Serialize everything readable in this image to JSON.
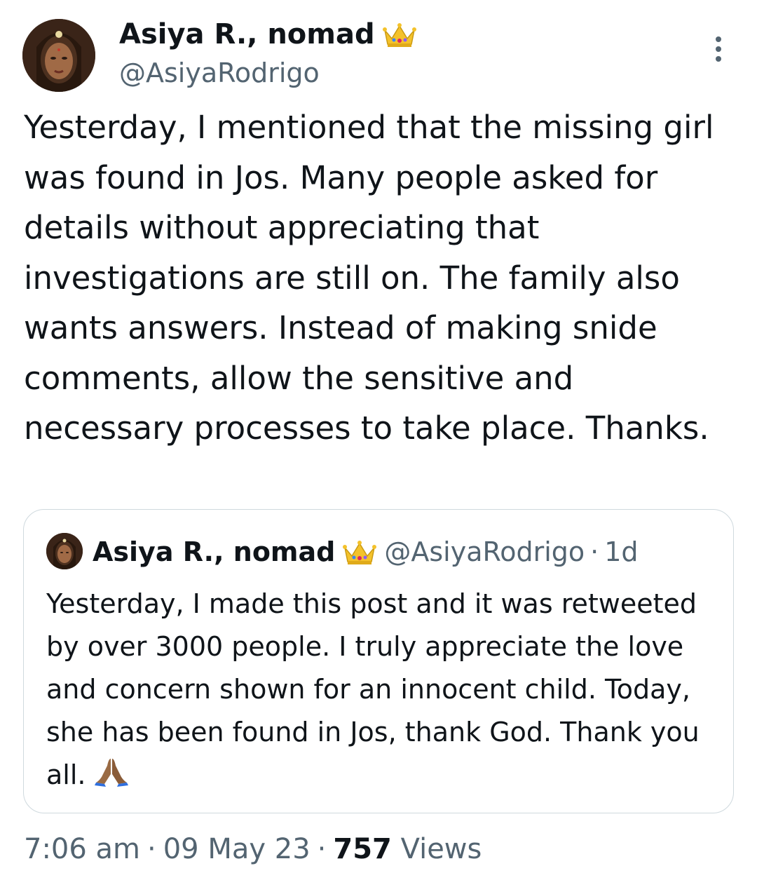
{
  "tweet": {
    "author": {
      "name": "Asiya R., nomad",
      "handle": "@AsiyaRodrigo",
      "avatar_icon": "profile-photo",
      "badge_icon": "crown-icon"
    },
    "text": "Yesterday, I mentioned that the missing girl was found in Jos. Many people asked for details without appreciating that investigations are still on. The family also wants answers. Instead of making snide comments, allow the sensitive and necessary processes to take place. Thanks.",
    "time": "7:06 am",
    "date": "09 May 23",
    "views_count": "757",
    "views_label": "Views",
    "separator": "·"
  },
  "quoted_tweet": {
    "author": {
      "name": "Asiya R., nomad",
      "handle": "@AsiyaRodrigo",
      "badge_icon": "crown-icon"
    },
    "age": "1d",
    "separator": "·",
    "text": "Yesterday, I made this post and it was retweeted by over 3000 people. I truly appreciate the love and concern shown for an innocent child. Today, she has been found in Jos, thank God. Thank you all.",
    "emoji_icon": "folded-hands-icon"
  },
  "colors": {
    "primary_text": "#0f1419",
    "secondary_text": "#536471",
    "border": "#cfd9de",
    "crown_gold": "#f4c22b"
  }
}
